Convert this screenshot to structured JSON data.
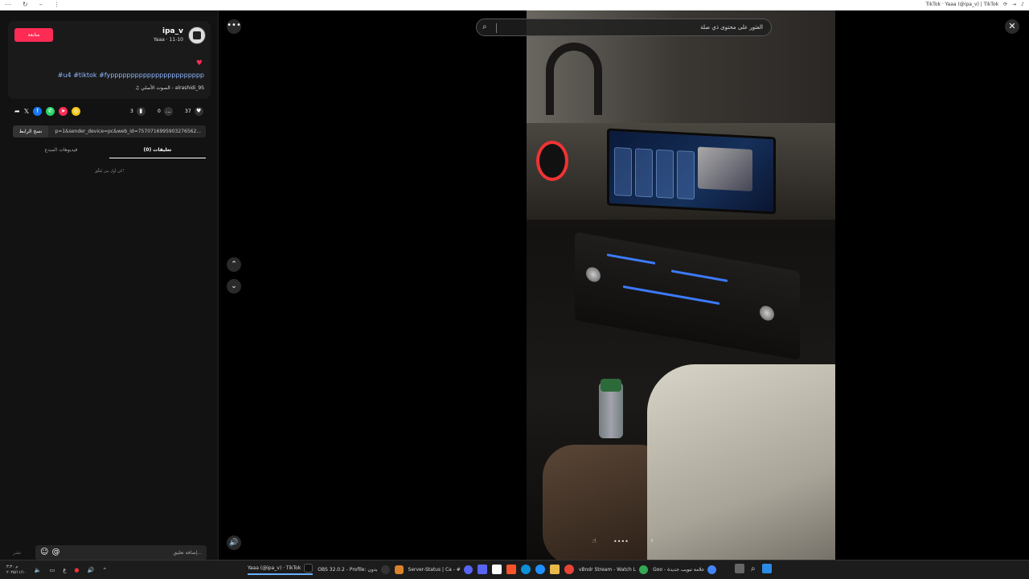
{
  "browser": {
    "tab_title": "TikTok · Yaaa (@ipa_v) | TikTok",
    "left_icons": [
      "dots-icon",
      "refresh-icon",
      "minimize-icon",
      "more-icon"
    ]
  },
  "post": {
    "follow_label": "متابعة",
    "username": "ipa_v",
    "subline": "Yaaa · 11-10",
    "hashtags": "#u4 #tiktok #fyppppppppppppppppppppppp",
    "music": "الصوت الأصلي - alrashidi_9S",
    "likes": "37",
    "comments": "0",
    "saves": "3",
    "copy_label": "نسخ الرابط",
    "url": "p=1&sender_device=pc&web_id=7570716995903276562...",
    "tab_comments": "تعليقات (0)",
    "tab_creator_videos": "فيديوهات المبدع",
    "empty_comments": "كن أول من يُعلّق!",
    "comment_placeholder": "إضافة تعليق...",
    "post_label": "نشر",
    "share_colors": [
      "#1877f2",
      "#25d366",
      "#fe2c55",
      "#f5c518"
    ]
  },
  "viewer": {
    "search_placeholder": "العثور على محتوى ذي صلة",
    "more_label": "•••",
    "close_label": "✕",
    "up_label": "⌃",
    "down_label": "⌄",
    "volume_label": "🔊",
    "dots_label": "••••",
    "back_label": "‹"
  },
  "taskbar": {
    "clock_time": "۳:۳۰ م",
    "clock_date": "۲۰۲۵/۱۱/۱۰",
    "lang": "ع",
    "tasks": [
      {
        "label": "Yaaa (@ipa_v) · TikTok",
        "color": "#111",
        "active": true
      },
      {
        "label": "OBS 32.0.2 - Profile: بدون",
        "color": "#333"
      },
      {
        "label": "",
        "color": "#d9822b"
      },
      {
        "label": "Server-Status | Ca - #",
        "color": "#5865f2"
      },
      {
        "label": "",
        "color": "#5865f2"
      },
      {
        "label": "",
        "color": "#fff"
      },
      {
        "label": "",
        "color": "#fb542b"
      },
      {
        "label": "",
        "color": "#0c8fd6"
      },
      {
        "label": "",
        "color": "#1e90ff"
      },
      {
        "label": "",
        "color": "#e8b84b"
      },
      {
        "label": "",
        "color": "#ea4335"
      },
      {
        "label": "vBndr Stream - Watch L",
        "color": "#34a853"
      },
      {
        "label": "Goo - علامة تبويب جديدة",
        "color": "#4285f4"
      }
    ]
  }
}
